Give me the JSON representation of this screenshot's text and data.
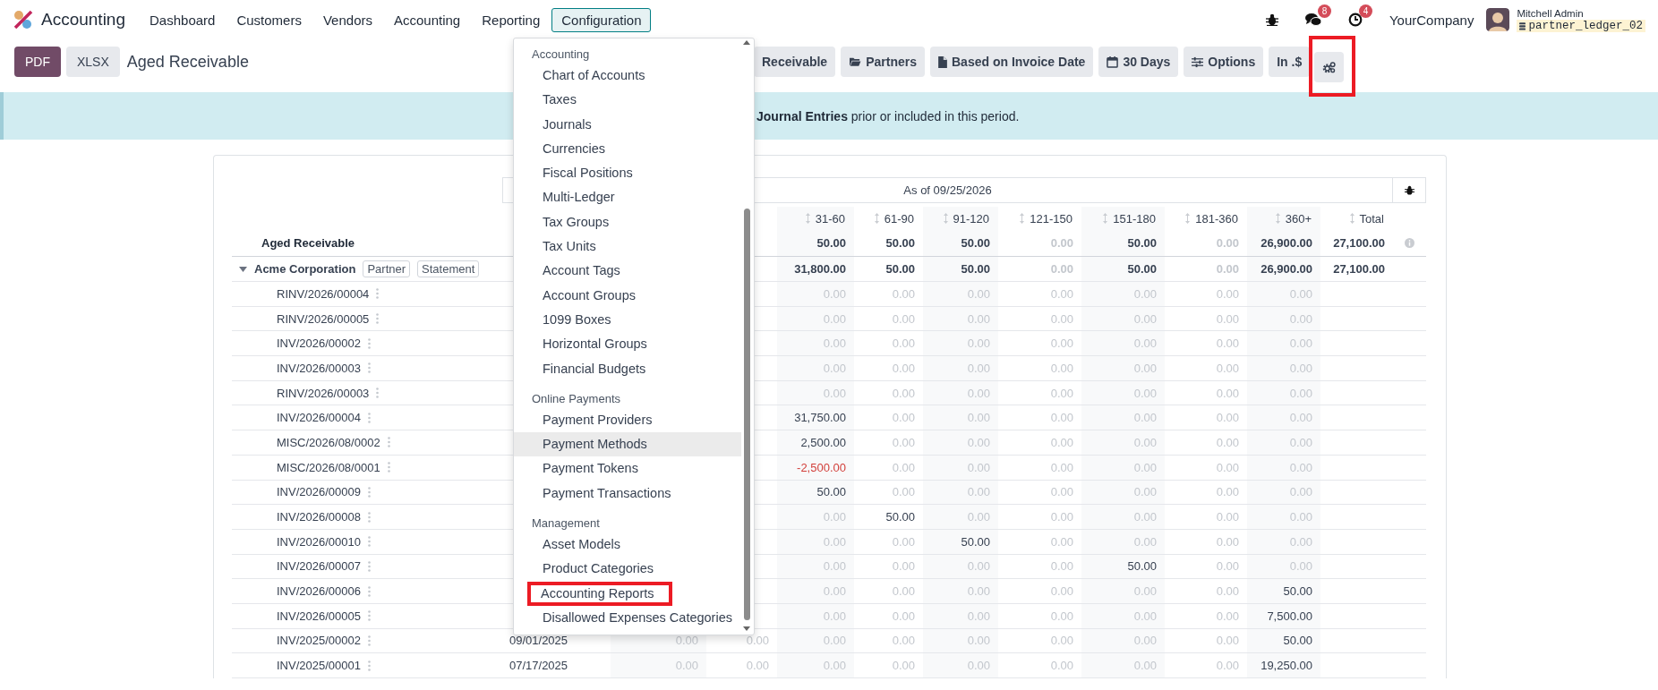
{
  "navbar": {
    "app_name": "Accounting",
    "menu": [
      {
        "label": "Dashboard",
        "selected": false
      },
      {
        "label": "Customers",
        "selected": false
      },
      {
        "label": "Vendors",
        "selected": false
      },
      {
        "label": "Accounting",
        "selected": false
      },
      {
        "label": "Reporting",
        "selected": false
      },
      {
        "label": "Configuration",
        "selected": true
      }
    ],
    "messages_badge": "8",
    "activities_badge": "4",
    "company": "YourCompany",
    "user_name": "Mitchell Admin",
    "database": "partner_ledger_02"
  },
  "toolbar": {
    "export_buttons": [
      {
        "label": "PDF",
        "kind": "primary"
      },
      {
        "label": "XLSX",
        "kind": "secondary"
      }
    ],
    "report_title": "Aged Receivable",
    "filters": [
      {
        "label": "Receivable",
        "kind": "plain",
        "outlined": false
      },
      {
        "label": "Partners",
        "kind": "folder",
        "outlined": false
      },
      {
        "label": "Based on Invoice Date",
        "kind": "file",
        "outlined": false
      },
      {
        "label": "30 Days",
        "kind": "calendar",
        "outlined": false
      },
      {
        "label": "Options",
        "kind": "sliders",
        "outlined": false
      },
      {
        "label": "In .$",
        "kind": "plain",
        "outlined": false
      },
      {
        "kind": "gears",
        "outlined": true
      }
    ]
  },
  "banner": {
    "text": "**Journal Entries** prior or included in this period."
  },
  "report": {
    "date_header": "As of 09/25/2026",
    "columns": [
      "",
      "",
      "",
      "31-60",
      "61-90",
      "91-120",
      "121-150",
      "151-180",
      "181-360",
      "360+",
      "Total"
    ],
    "rows": [
      {
        "kind": "total",
        "label": "Aged Receivable",
        "cells": [
          "",
          "",
          "",
          {
            "text": "50.00",
            "kind": "normal"
          },
          {
            "text": "50.00",
            "kind": "normal"
          },
          {
            "text": "50.00",
            "kind": "normal"
          },
          {
            "text": "0.00",
            "kind": "muted"
          },
          {
            "text": "50.00",
            "kind": "normal"
          },
          {
            "text": "0.00",
            "kind": "muted"
          },
          {
            "text": "26,900.00",
            "kind": "normal"
          },
          {
            "text": "27,100.00",
            "kind": "normal"
          }
        ]
      },
      {
        "kind": "partner",
        "label": "Acme Corporation",
        "expanded": true,
        "tags": [
          "Partner",
          "Statement"
        ],
        "cells": [
          "",
          "",
          "",
          {
            "text": "31,800.00",
            "kind": "normal"
          },
          {
            "text": "50.00",
            "kind": "normal"
          },
          {
            "text": "50.00",
            "kind": "normal"
          },
          {
            "text": "0.00",
            "kind": "muted"
          },
          {
            "text": "50.00",
            "kind": "normal"
          },
          {
            "text": "0.00",
            "kind": "muted"
          },
          {
            "text": "26,900.00",
            "kind": "normal"
          },
          {
            "text": "27,100.00",
            "kind": "normal"
          }
        ]
      },
      {
        "kind": "line",
        "label": "RINV/2026/00004",
        "cells": [
          "",
          "",
          "",
          {
            "text": "0.00",
            "kind": "muted"
          },
          {
            "text": "0.00",
            "kind": "muted"
          },
          {
            "text": "0.00",
            "kind": "muted"
          },
          {
            "text": "0.00",
            "kind": "muted"
          },
          {
            "text": "0.00",
            "kind": "muted"
          },
          {
            "text": "0.00",
            "kind": "muted"
          },
          {
            "text": "0.00",
            "kind": "muted"
          },
          ""
        ]
      },
      {
        "kind": "line",
        "label": "RINV/2026/00005",
        "cells": [
          "",
          "",
          "",
          {
            "text": "0.00",
            "kind": "muted"
          },
          {
            "text": "0.00",
            "kind": "muted"
          },
          {
            "text": "0.00",
            "kind": "muted"
          },
          {
            "text": "0.00",
            "kind": "muted"
          },
          {
            "text": "0.00",
            "kind": "muted"
          },
          {
            "text": "0.00",
            "kind": "muted"
          },
          {
            "text": "0.00",
            "kind": "muted"
          },
          ""
        ]
      },
      {
        "kind": "line",
        "label": "INV/2026/00002",
        "cells": [
          "",
          "",
          "",
          {
            "text": "0.00",
            "kind": "muted"
          },
          {
            "text": "0.00",
            "kind": "muted"
          },
          {
            "text": "0.00",
            "kind": "muted"
          },
          {
            "text": "0.00",
            "kind": "muted"
          },
          {
            "text": "0.00",
            "kind": "muted"
          },
          {
            "text": "0.00",
            "kind": "muted"
          },
          {
            "text": "0.00",
            "kind": "muted"
          },
          ""
        ]
      },
      {
        "kind": "line",
        "label": "INV/2026/00003",
        "cells": [
          "",
          "",
          "",
          {
            "text": "0.00",
            "kind": "muted"
          },
          {
            "text": "0.00",
            "kind": "muted"
          },
          {
            "text": "0.00",
            "kind": "muted"
          },
          {
            "text": "0.00",
            "kind": "muted"
          },
          {
            "text": "0.00",
            "kind": "muted"
          },
          {
            "text": "0.00",
            "kind": "muted"
          },
          {
            "text": "0.00",
            "kind": "muted"
          },
          ""
        ]
      },
      {
        "kind": "line",
        "label": "RINV/2026/00003",
        "cells": [
          "",
          "",
          "",
          {
            "text": "0.00",
            "kind": "muted"
          },
          {
            "text": "0.00",
            "kind": "muted"
          },
          {
            "text": "0.00",
            "kind": "muted"
          },
          {
            "text": "0.00",
            "kind": "muted"
          },
          {
            "text": "0.00",
            "kind": "muted"
          },
          {
            "text": "0.00",
            "kind": "muted"
          },
          {
            "text": "0.00",
            "kind": "muted"
          },
          ""
        ]
      },
      {
        "kind": "line",
        "label": "INV/2026/00004",
        "cells": [
          "",
          "",
          "",
          {
            "text": "31,750.00",
            "kind": "normal"
          },
          {
            "text": "0.00",
            "kind": "muted"
          },
          {
            "text": "0.00",
            "kind": "muted"
          },
          {
            "text": "0.00",
            "kind": "muted"
          },
          {
            "text": "0.00",
            "kind": "muted"
          },
          {
            "text": "0.00",
            "kind": "muted"
          },
          {
            "text": "0.00",
            "kind": "muted"
          },
          ""
        ]
      },
      {
        "kind": "line",
        "label": "MISC/2026/08/0002",
        "cells": [
          "",
          "",
          "",
          {
            "text": "2,500.00",
            "kind": "normal"
          },
          {
            "text": "0.00",
            "kind": "muted"
          },
          {
            "text": "0.00",
            "kind": "muted"
          },
          {
            "text": "0.00",
            "kind": "muted"
          },
          {
            "text": "0.00",
            "kind": "muted"
          },
          {
            "text": "0.00",
            "kind": "muted"
          },
          {
            "text": "0.00",
            "kind": "muted"
          },
          ""
        ]
      },
      {
        "kind": "line",
        "label": "MISC/2026/08/0001",
        "cells": [
          "",
          "",
          "",
          {
            "text": "-2,500.00",
            "kind": "negative"
          },
          {
            "text": "0.00",
            "kind": "muted"
          },
          {
            "text": "0.00",
            "kind": "muted"
          },
          {
            "text": "0.00",
            "kind": "muted"
          },
          {
            "text": "0.00",
            "kind": "muted"
          },
          {
            "text": "0.00",
            "kind": "muted"
          },
          {
            "text": "0.00",
            "kind": "muted"
          },
          ""
        ]
      },
      {
        "kind": "line",
        "label": "INV/2026/00009",
        "cells": [
          "",
          "",
          "",
          {
            "text": "50.00",
            "kind": "normal"
          },
          {
            "text": "0.00",
            "kind": "muted"
          },
          {
            "text": "0.00",
            "kind": "muted"
          },
          {
            "text": "0.00",
            "kind": "muted"
          },
          {
            "text": "0.00",
            "kind": "muted"
          },
          {
            "text": "0.00",
            "kind": "muted"
          },
          {
            "text": "0.00",
            "kind": "muted"
          },
          ""
        ]
      },
      {
        "kind": "line",
        "label": "INV/2026/00008",
        "cells": [
          "",
          "",
          "",
          {
            "text": "0.00",
            "kind": "muted"
          },
          {
            "text": "50.00",
            "kind": "normal"
          },
          {
            "text": "0.00",
            "kind": "muted"
          },
          {
            "text": "0.00",
            "kind": "muted"
          },
          {
            "text": "0.00",
            "kind": "muted"
          },
          {
            "text": "0.00",
            "kind": "muted"
          },
          {
            "text": "0.00",
            "kind": "muted"
          },
          ""
        ]
      },
      {
        "kind": "line",
        "label": "INV/2026/00010",
        "cells": [
          "",
          "",
          "",
          {
            "text": "0.00",
            "kind": "muted"
          },
          {
            "text": "0.00",
            "kind": "muted"
          },
          {
            "text": "50.00",
            "kind": "normal"
          },
          {
            "text": "0.00",
            "kind": "muted"
          },
          {
            "text": "0.00",
            "kind": "muted"
          },
          {
            "text": "0.00",
            "kind": "muted"
          },
          {
            "text": "0.00",
            "kind": "muted"
          },
          ""
        ]
      },
      {
        "kind": "line",
        "label": "INV/2026/00007",
        "cells": [
          "",
          "",
          "",
          {
            "text": "0.00",
            "kind": "muted"
          },
          {
            "text": "0.00",
            "kind": "muted"
          },
          {
            "text": "0.00",
            "kind": "muted"
          },
          {
            "text": "0.00",
            "kind": "muted"
          },
          {
            "text": "50.00",
            "kind": "normal"
          },
          {
            "text": "0.00",
            "kind": "muted"
          },
          {
            "text": "0.00",
            "kind": "muted"
          },
          ""
        ]
      },
      {
        "kind": "line",
        "label": "INV/2026/00006",
        "cells": [
          "",
          "",
          "",
          {
            "text": "0.00",
            "kind": "muted"
          },
          {
            "text": "0.00",
            "kind": "muted"
          },
          {
            "text": "0.00",
            "kind": "muted"
          },
          {
            "text": "0.00",
            "kind": "muted"
          },
          {
            "text": "0.00",
            "kind": "muted"
          },
          {
            "text": "0.00",
            "kind": "muted"
          },
          {
            "text": "50.00",
            "kind": "normal"
          },
          ""
        ]
      },
      {
        "kind": "line",
        "label": "INV/2026/00005",
        "cells": [
          "",
          "",
          "",
          {
            "text": "0.00",
            "kind": "muted"
          },
          {
            "text": "0.00",
            "kind": "muted"
          },
          {
            "text": "0.00",
            "kind": "muted"
          },
          {
            "text": "0.00",
            "kind": "muted"
          },
          {
            "text": "0.00",
            "kind": "muted"
          },
          {
            "text": "0.00",
            "kind": "muted"
          },
          {
            "text": "7,500.00",
            "kind": "normal"
          },
          ""
        ]
      },
      {
        "kind": "line",
        "label": "INV/2025/00002",
        "cells": [
          {
            "text": "09/01/2025",
            "kind": "normal"
          },
          {
            "text": "0.00",
            "kind": "muted"
          },
          {
            "text": "0.00",
            "kind": "muted"
          },
          {
            "text": "0.00",
            "kind": "muted"
          },
          {
            "text": "0.00",
            "kind": "muted"
          },
          {
            "text": "0.00",
            "kind": "muted"
          },
          {
            "text": "0.00",
            "kind": "muted"
          },
          {
            "text": "0.00",
            "kind": "muted"
          },
          {
            "text": "0.00",
            "kind": "muted"
          },
          {
            "text": "50.00",
            "kind": "normal"
          },
          ""
        ]
      },
      {
        "kind": "line",
        "label": "INV/2025/00001",
        "cells": [
          {
            "text": "07/17/2025",
            "kind": "normal"
          },
          {
            "text": "0.00",
            "kind": "muted"
          },
          {
            "text": "0.00",
            "kind": "muted"
          },
          {
            "text": "0.00",
            "kind": "muted"
          },
          {
            "text": "0.00",
            "kind": "muted"
          },
          {
            "text": "0.00",
            "kind": "muted"
          },
          {
            "text": "0.00",
            "kind": "muted"
          },
          {
            "text": "0.00",
            "kind": "muted"
          },
          {
            "text": "0.00",
            "kind": "muted"
          },
          {
            "text": "19,250.00",
            "kind": "normal"
          },
          ""
        ]
      }
    ]
  },
  "dropdown": {
    "sections": [
      {
        "title": "Accounting",
        "items": [
          {
            "label": "Chart of Accounts",
            "hovered": false,
            "outlined": false
          },
          {
            "label": "Taxes",
            "hovered": false,
            "outlined": false
          },
          {
            "label": "Journals",
            "hovered": false,
            "outlined": false
          },
          {
            "label": "Currencies",
            "hovered": false,
            "outlined": false
          },
          {
            "label": "Fiscal Positions",
            "hovered": false,
            "outlined": false
          },
          {
            "label": "Multi-Ledger",
            "hovered": false,
            "outlined": false
          },
          {
            "label": "Tax Groups",
            "hovered": false,
            "outlined": false
          },
          {
            "label": "Tax Units",
            "hovered": false,
            "outlined": false
          },
          {
            "label": "Account Tags",
            "hovered": false,
            "outlined": false
          },
          {
            "label": "Account Groups",
            "hovered": false,
            "outlined": false
          },
          {
            "label": "1099 Boxes",
            "hovered": false,
            "outlined": false
          },
          {
            "label": "Horizontal Groups",
            "hovered": false,
            "outlined": false
          },
          {
            "label": "Financial Budgets",
            "hovered": false,
            "outlined": false
          }
        ]
      },
      {
        "title": "Online Payments",
        "items": [
          {
            "label": "Payment Providers",
            "hovered": false,
            "outlined": false
          },
          {
            "label": "Payment Methods",
            "hovered": true,
            "outlined": false
          },
          {
            "label": "Payment Tokens",
            "hovered": false,
            "outlined": false
          },
          {
            "label": "Payment Transactions",
            "hovered": false,
            "outlined": false
          }
        ]
      },
      {
        "title": "Management",
        "items": [
          {
            "label": "Asset Models",
            "hovered": false,
            "outlined": false
          },
          {
            "label": "Product Categories",
            "hovered": false,
            "outlined": false
          },
          {
            "label": "Accounting Reports",
            "hovered": false,
            "outlined": true
          },
          {
            "label": "Disallowed Expenses Categories",
            "hovered": false,
            "outlined": false
          }
        ]
      }
    ]
  }
}
